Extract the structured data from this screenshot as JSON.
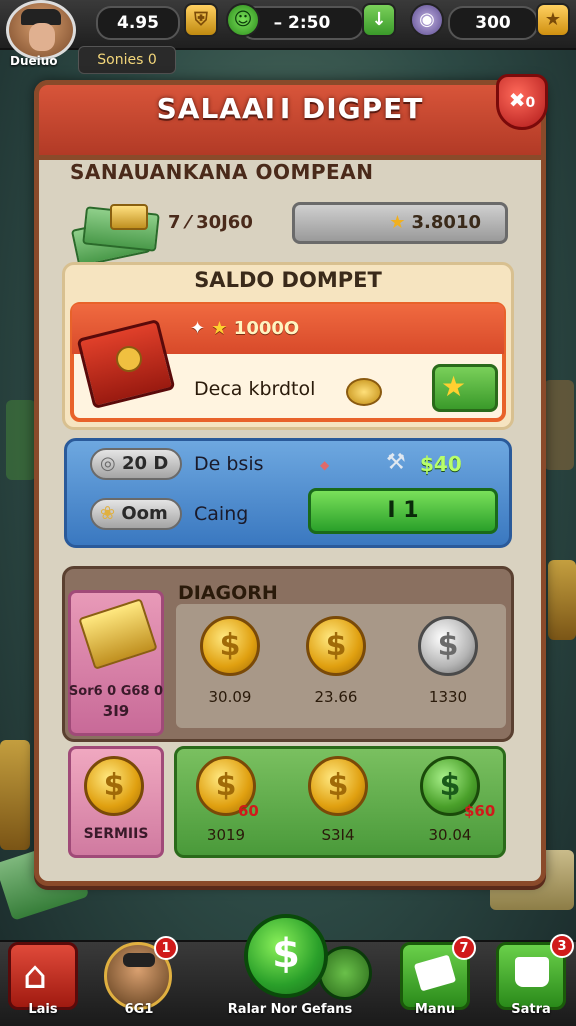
{
  "hud": {
    "player_name": "Dueiuo",
    "subtitle": "Sonies 0",
    "resources": [
      {
        "value": "4.95",
        "icon": "shield-gold-icon",
        "color": "#f0b020"
      },
      {
        "value": "– 2:50",
        "icon": "globe-green-icon",
        "color": "#3aa02a"
      },
      {
        "value": "300",
        "icon": "gem-purple-icon",
        "color": "#7a6ab0"
      }
    ],
    "close_badge": "0"
  },
  "panel": {
    "title": "SALAAI I DIGPET",
    "section_heading": "SANAUANKANA OOMPEAN",
    "cash_value": "7 ⁄ 30J60",
    "balance_value": "3.8010"
  },
  "saldo": {
    "title": "SALDO DOMPET",
    "reward_value": "1000O",
    "description": "Deca kbrdtol"
  },
  "exchange": {
    "row1_pill": "20 D",
    "row1_label": "De bsis",
    "row1_value": "$40",
    "row2_pill": "Oom",
    "row2_label": "Caing",
    "button_label": "I 1"
  },
  "diagorh": {
    "title": "DIAGORH",
    "promo_text": "Sor6 0 G68 0",
    "promo_value": "3I9",
    "coins": [
      {
        "label": "30.09",
        "type": "gold"
      },
      {
        "label": "23.66",
        "type": "gold"
      },
      {
        "label": "1330",
        "type": "silver"
      }
    ]
  },
  "earnings": {
    "side_label": "SERMIIS",
    "coins": [
      {
        "label": "3019",
        "tag": "60",
        "type": "gold"
      },
      {
        "label": "S3I4",
        "tag": "",
        "type": "gold"
      },
      {
        "label": "30.04",
        "tag": "$60",
        "type": "green"
      }
    ]
  },
  "bottom_nav": {
    "items": [
      {
        "label": "Lais",
        "icon": "home-icon",
        "badge": ""
      },
      {
        "label": "6G1",
        "icon": "avatar-icon",
        "badge": "1"
      },
      {
        "label": "Ralar Nor Gefans",
        "icon": "dollar-icon",
        "badge": ""
      },
      {
        "label": "Manu",
        "icon": "envelope-icon",
        "badge": "7"
      },
      {
        "label": "Satra",
        "icon": "shop-icon",
        "badge": "3"
      }
    ]
  }
}
